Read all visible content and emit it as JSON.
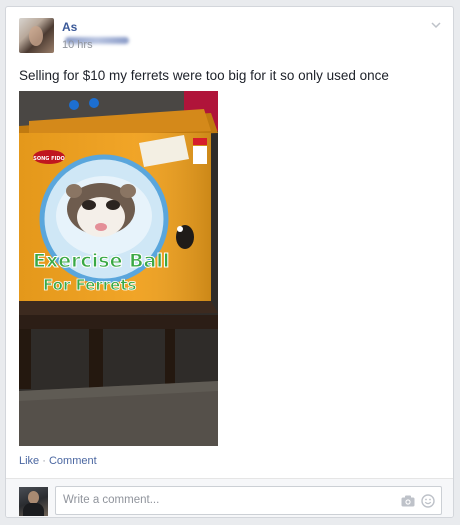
{
  "post": {
    "author_name_visible": "As",
    "timestamp": "10 hrs",
    "text": "Selling for $10 my ferrets were too big for it so only used once",
    "photo": {
      "box_title_line1": "Exercise Ball",
      "box_title_line2": "For Ferrets",
      "brand_label": "SONG FIDO",
      "size_label": "11\""
    }
  },
  "actions": {
    "like_label": "Like",
    "separator": " · ",
    "comment_label": "Comment"
  },
  "comment_box": {
    "placeholder": "Write a comment..."
  },
  "icons": {
    "options": "chevron-down-icon",
    "camera": "camera-icon",
    "emoji": "smiley-icon"
  },
  "colors": {
    "link": "#3b5998",
    "background": "#e9ebee",
    "box_orange": "#f0a01c",
    "title_green": "#3aa845"
  }
}
